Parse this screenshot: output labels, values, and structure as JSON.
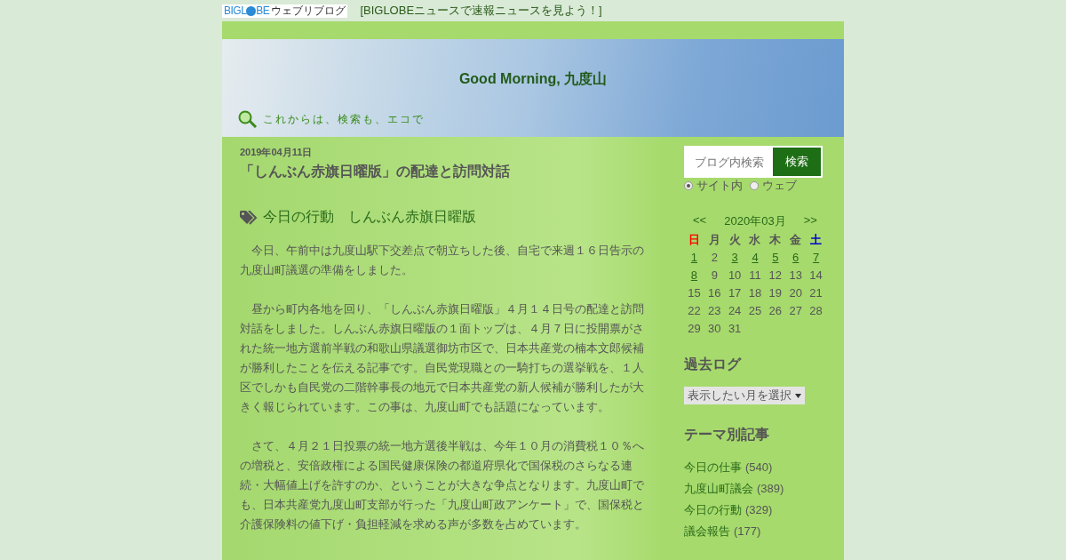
{
  "top_bar": {
    "logo": {
      "parts": [
        "BIGL",
        "BE"
      ],
      "suffix": "ウェブリブログ"
    },
    "news_link": "[BIGLOBEニュースで速報ニュースを見よう！]"
  },
  "header": {
    "title": "Good Morning, 九度山",
    "tagline": "これからは、検索も、エコで"
  },
  "article": {
    "date": "2019年04月11日",
    "title": "「しんぶん赤旗日曜版」の配達と訪問対話",
    "tags": [
      "今日の行動",
      "しんぶん赤旗日曜版"
    ],
    "paragraphs": [
      "　今日、午前中は九度山駅下交差点で朝立ちした後、自宅で来週１６日告示の九度山町議選の準備をしました。",
      "　昼から町内各地を回り、「しんぶん赤旗日曜版」４月１４日号の配達と訪問対話をしました。しんぶん赤旗日曜版の１面トップは、４月７日に投開票がされた統一地方選前半戦の和歌山県議選御坊市区で、日本共産党の楠本文郎候補が勝利したことを伝える記事です。自民党現職との一騎打ちの選挙戦を、１人区でしかも自民党の二階幹事長の地元で日本共産党の新人候補が勝利したが大きく報じられています。この事は、九度山町でも話題になっています。",
      "　さて、４月２１日投票の統一地方選後半戦は、今年１０月の消費税１０％への増税と、安倍政権による国民健康保険の都道府県化で国保税のさらなる連続・大幅値上げを許すのか、ということが大きな争点となります。九度山町でも、日本共産党九度山町支部が行った「九度山町政アンケート」で、国保税と介護保険料の値下げ・負担軽減を求める声が多数を占めています。"
    ]
  },
  "sidebar": {
    "search": {
      "placeholder": "ブログ内検索",
      "button": "検索",
      "scopes": [
        {
          "label": "サイト内",
          "selected": true
        },
        {
          "label": "ウェブ",
          "selected": false
        }
      ]
    },
    "calendar": {
      "prev": "<<",
      "month": "2020年03月",
      "next": ">>",
      "weekdays": [
        {
          "label": "日",
          "color": "#ff0000"
        },
        {
          "label": "月",
          "color": "#555555"
        },
        {
          "label": "火",
          "color": "#555555"
        },
        {
          "label": "水",
          "color": "#555555"
        },
        {
          "label": "木",
          "color": "#555555"
        },
        {
          "label": "金",
          "color": "#555555"
        },
        {
          "label": "土",
          "color": "#0000cc"
        }
      ],
      "days": [
        {
          "label": "1",
          "linked": true
        },
        {
          "label": "2",
          "linked": false
        },
        {
          "label": "3",
          "linked": true
        },
        {
          "label": "4",
          "linked": true
        },
        {
          "label": "5",
          "linked": true
        },
        {
          "label": "6",
          "linked": true
        },
        {
          "label": "7",
          "linked": true
        },
        {
          "label": "8",
          "linked": true
        },
        {
          "label": "9",
          "linked": false
        },
        {
          "label": "10",
          "linked": false
        },
        {
          "label": "11",
          "linked": false
        },
        {
          "label": "12",
          "linked": false
        },
        {
          "label": "13",
          "linked": false
        },
        {
          "label": "14",
          "linked": false
        },
        {
          "label": "15",
          "linked": false
        },
        {
          "label": "16",
          "linked": false
        },
        {
          "label": "17",
          "linked": false
        },
        {
          "label": "18",
          "linked": false
        },
        {
          "label": "19",
          "linked": false
        },
        {
          "label": "20",
          "linked": false
        },
        {
          "label": "21",
          "linked": false
        },
        {
          "label": "22",
          "linked": false
        },
        {
          "label": "23",
          "linked": false
        },
        {
          "label": "24",
          "linked": false
        },
        {
          "label": "25",
          "linked": false
        },
        {
          "label": "26",
          "linked": false
        },
        {
          "label": "27",
          "linked": false
        },
        {
          "label": "28",
          "linked": false
        },
        {
          "label": "29",
          "linked": false
        },
        {
          "label": "30",
          "linked": false
        },
        {
          "label": "31",
          "linked": false
        }
      ]
    },
    "archive": {
      "heading": "過去ログ",
      "select": "表示したい月を選択"
    },
    "themes": {
      "heading": "テーマ別記事",
      "items": [
        {
          "label": "今日の仕事",
          "count": "(540)"
        },
        {
          "label": "九度山町議会",
          "count": "(389)"
        },
        {
          "label": "今日の行動",
          "count": "(329)"
        },
        {
          "label": "議会報告",
          "count": "(177)"
        }
      ]
    }
  }
}
